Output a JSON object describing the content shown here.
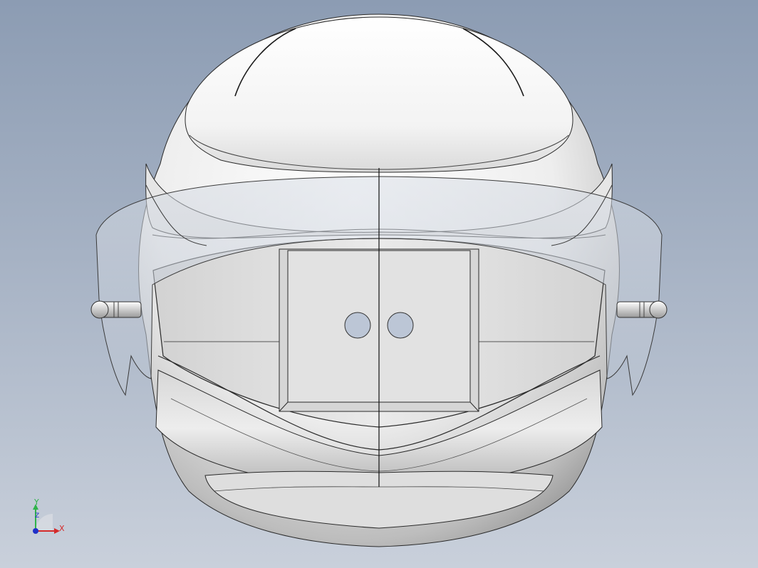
{
  "viewport": {
    "background_top": "#8c9cb3",
    "background_bottom": "#c9d0db"
  },
  "model": {
    "name": "helmet",
    "shell_color": "#f2f2f2",
    "visor_color": "#c5ccd6",
    "sensor_color": "#bcc6d6",
    "edge_color": "#202020"
  },
  "triad": {
    "y_label": "Y",
    "x_label": "X",
    "z_label": "Z",
    "y_color": "#2fb34a",
    "x_color": "#d42a2a",
    "z_color": "#2030c8"
  }
}
